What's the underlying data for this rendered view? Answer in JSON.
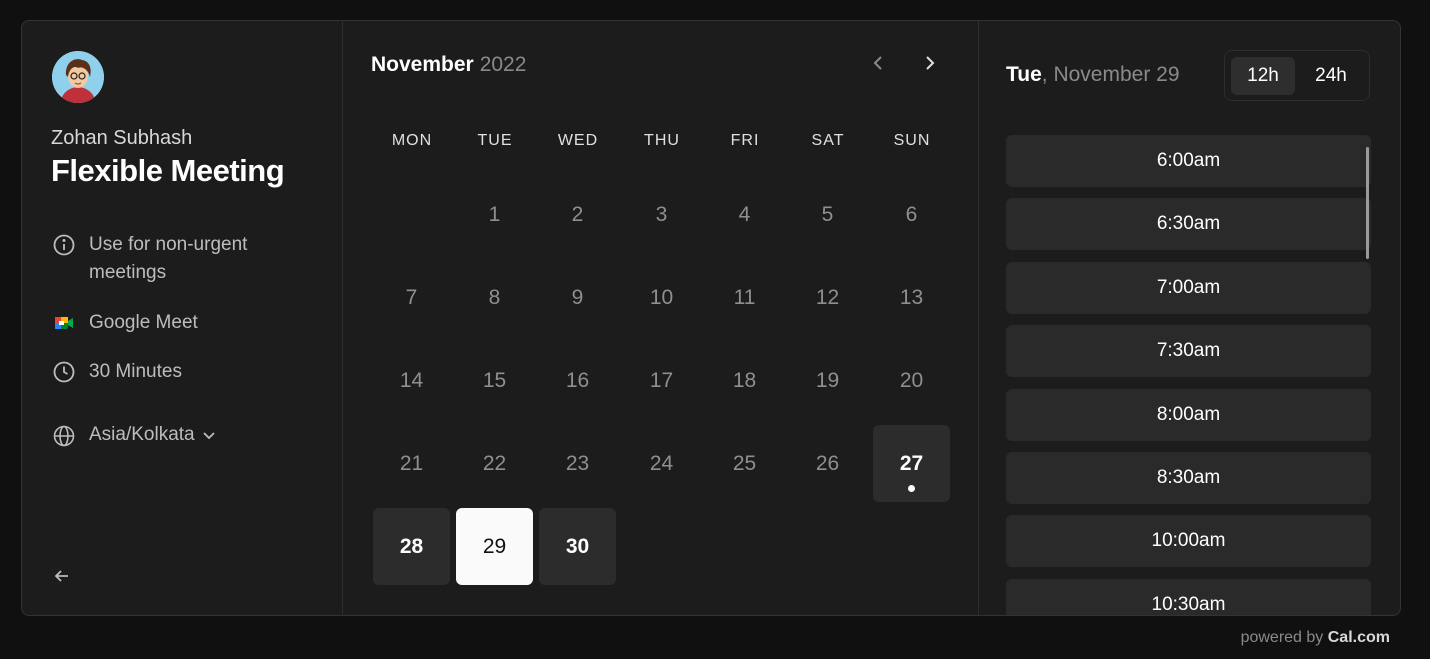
{
  "profile": {
    "name": "Zohan Subhash",
    "event_title": "Flexible Meeting",
    "description": "Use for non-urgent meetings",
    "location": "Google Meet",
    "duration": "30 Minutes",
    "timezone": "Asia/Kolkata"
  },
  "calendar": {
    "month": "November",
    "year": "2022",
    "weekdays": [
      "MON",
      "TUE",
      "WED",
      "THU",
      "FRI",
      "SAT",
      "SUN"
    ],
    "days": [
      "1",
      "2",
      "3",
      "4",
      "5",
      "6",
      "7",
      "8",
      "9",
      "10",
      "11",
      "12",
      "13",
      "14",
      "15",
      "16",
      "17",
      "18",
      "19",
      "20",
      "21",
      "22",
      "23",
      "24",
      "25",
      "26",
      "27",
      "28",
      "29",
      "30"
    ],
    "available_days": [
      "27",
      "28",
      "29",
      "30"
    ],
    "selected_day": "29",
    "today": "27"
  },
  "slots": {
    "day_name": "Tue",
    "date_label": ", November 29",
    "format_12h": "12h",
    "format_24h": "24h",
    "times": [
      "6:00am",
      "6:30am",
      "7:00am",
      "7:30am",
      "8:00am",
      "8:30am",
      "10:00am",
      "10:30am"
    ]
  },
  "footer": {
    "powered_by": "powered by ",
    "brand": "Cal.com"
  },
  "colors": {
    "background": "#101010",
    "card": "#1c1c1c",
    "slot": "#2a2a2a",
    "selected_day": "#fafafa"
  },
  "icons": [
    "info-icon",
    "google-meet-icon",
    "clock-icon",
    "globe-icon",
    "chevron-down-icon",
    "arrow-left-icon",
    "chevron-left-icon",
    "chevron-right-icon"
  ]
}
